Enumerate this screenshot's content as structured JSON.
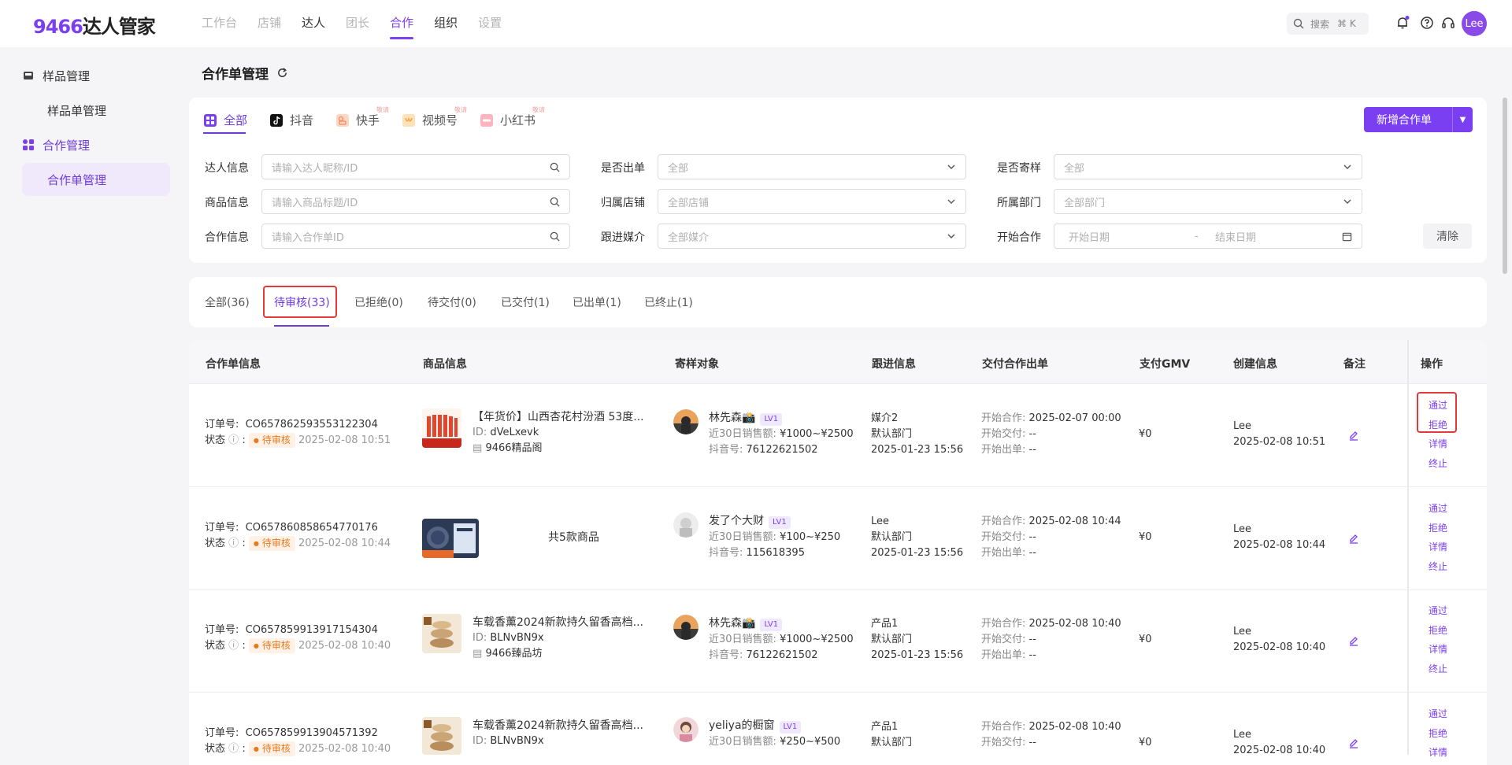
{
  "app": {
    "logo_num": "9466",
    "logo_text": "达人管家",
    "avatar": "Lee"
  },
  "topnav": [
    {
      "label": "工作台",
      "state": "disabled"
    },
    {
      "label": "店铺",
      "state": "disabled"
    },
    {
      "label": "达人",
      "state": "dark"
    },
    {
      "label": "团长",
      "state": "disabled"
    },
    {
      "label": "合作",
      "state": "active"
    },
    {
      "label": "组织",
      "state": "dark"
    },
    {
      "label": "设置",
      "state": "disabled"
    }
  ],
  "search": {
    "label": "搜索",
    "shortcut": "⌘ K"
  },
  "sidebar": {
    "group1": "样品管理",
    "item1": "样品单管理",
    "group2": "合作管理",
    "item2": "合作单管理"
  },
  "page": {
    "title": "合作单管理"
  },
  "platform_tabs": [
    {
      "label": "全部"
    },
    {
      "label": "抖音"
    },
    {
      "label": "快手",
      "badge": "敬请"
    },
    {
      "label": "视频号",
      "badge": "敬请"
    },
    {
      "label": "小红书",
      "badge": "敬请"
    }
  ],
  "new_button": "新增合作单",
  "filters": {
    "influencer_label": "达人信息",
    "influencer_ph": "请输入达人昵称/ID",
    "product_label": "商品信息",
    "product_ph": "请输入商品标题/ID",
    "coop_label": "合作信息",
    "coop_ph": "请输入合作单ID",
    "shipped_label": "是否出单",
    "shipped_val": "全部",
    "store_label": "归属店铺",
    "store_val": "全部店铺",
    "media_label": "跟进媒介",
    "media_val": "全部媒介",
    "sample_label": "是否寄样",
    "sample_val": "全部",
    "dept_label": "所属部门",
    "dept_val": "全部部门",
    "start_label": "开始合作",
    "start_date_ph": "开始日期",
    "dash": "-",
    "end_date_ph": "结束日期",
    "clear": "清除"
  },
  "status_tabs": [
    {
      "label": "全部(36)"
    },
    {
      "label": "待审核(33)"
    },
    {
      "label": "已拒绝(0)"
    },
    {
      "label": "待交付(0)"
    },
    {
      "label": "已交付(1)"
    },
    {
      "label": "已出单(1)"
    },
    {
      "label": "已终止(1)"
    }
  ],
  "columns": [
    "合作单信息",
    "商品信息",
    "寄样对象",
    "跟进信息",
    "交付合作出单",
    "支付GMV",
    "创建信息",
    "备注",
    "操作"
  ],
  "labels": {
    "order_no": "订单号:",
    "status": "状态",
    "colon": ":",
    "id": "ID:",
    "sales30": "近30日销售额:",
    "douyin": "抖音号:",
    "start_coop": "开始合作:",
    "start_deliver": "开始交付:",
    "start_ship": "开始出单:",
    "op_pass": "通过",
    "op_reject": "拒绝",
    "op_detail": "详情",
    "op_end": "终止"
  },
  "rows": [
    {
      "order_no": "CO657862593553122304",
      "status": "待审核",
      "status_time": "2025-02-08 10:51",
      "product_title": "【年货价】山西杏花村汾酒 53度...",
      "product_id": "dVeLxevk",
      "product_shop": "9466精品阁",
      "influencer": "林先森📸",
      "level": "LV1",
      "sales": "¥1000~¥2500",
      "douyin_id": "76122621502",
      "follow_media": "媒介2",
      "follow_dept": "默认部门",
      "follow_time": "2025-01-23 15:56",
      "coop_start": "2025-02-07 00:00",
      "deliver_start": "--",
      "ship_start": "--",
      "gmv": "¥0",
      "creator": "Lee",
      "create_time": "2025-02-08 10:51"
    },
    {
      "order_no": "CO657860858654770176",
      "status": "待审核",
      "status_time": "2025-02-08 10:44",
      "product_multi": "共5款商品",
      "influencer": "发了个大财",
      "level": "LV1",
      "sales": "¥100~¥250",
      "douyin_id": "115618395",
      "follow_media": "Lee",
      "follow_dept": "默认部门",
      "follow_time": "2025-01-23 15:56",
      "coop_start": "2025-02-08 10:44",
      "deliver_start": "--",
      "ship_start": "--",
      "gmv": "¥0",
      "creator": "Lee",
      "create_time": "2025-02-08 10:44"
    },
    {
      "order_no": "CO657859913917154304",
      "status": "待审核",
      "status_time": "2025-02-08 10:40",
      "product_title": "车载香薰2024新款持久留香高档...",
      "product_id": "BLNvBN9x",
      "product_shop": "9466臻品坊",
      "influencer": "林先森📸",
      "level": "LV1",
      "sales": "¥1000~¥2500",
      "douyin_id": "76122621502",
      "follow_media": "产品1",
      "follow_dept": "默认部门",
      "follow_time": "2025-01-23 15:56",
      "coop_start": "2025-02-08 10:40",
      "deliver_start": "--",
      "ship_start": "--",
      "gmv": "¥0",
      "creator": "Lee",
      "create_time": "2025-02-08 10:40"
    },
    {
      "order_no": "CO657859913904571392",
      "status": "待审核",
      "status_time": "2025-02-08 10:40",
      "product_title": "车载香薰2024新款持久留香高档...",
      "product_id": "BLNvBN9x",
      "influencer": "yeliya的橱窗",
      "level": "LV1",
      "sales": "¥250~¥500",
      "follow_media": "产品1",
      "follow_dept": "默认部门",
      "coop_start": "2025-02-08 10:40",
      "deliver_start": "--",
      "gmv": "¥0",
      "creator": "Lee",
      "create_time": "2025-02-08 10:40"
    }
  ],
  "colors": {
    "accent": "#7b3ff2",
    "highlight": "#e23a3a",
    "pending": "#e57b1e"
  }
}
